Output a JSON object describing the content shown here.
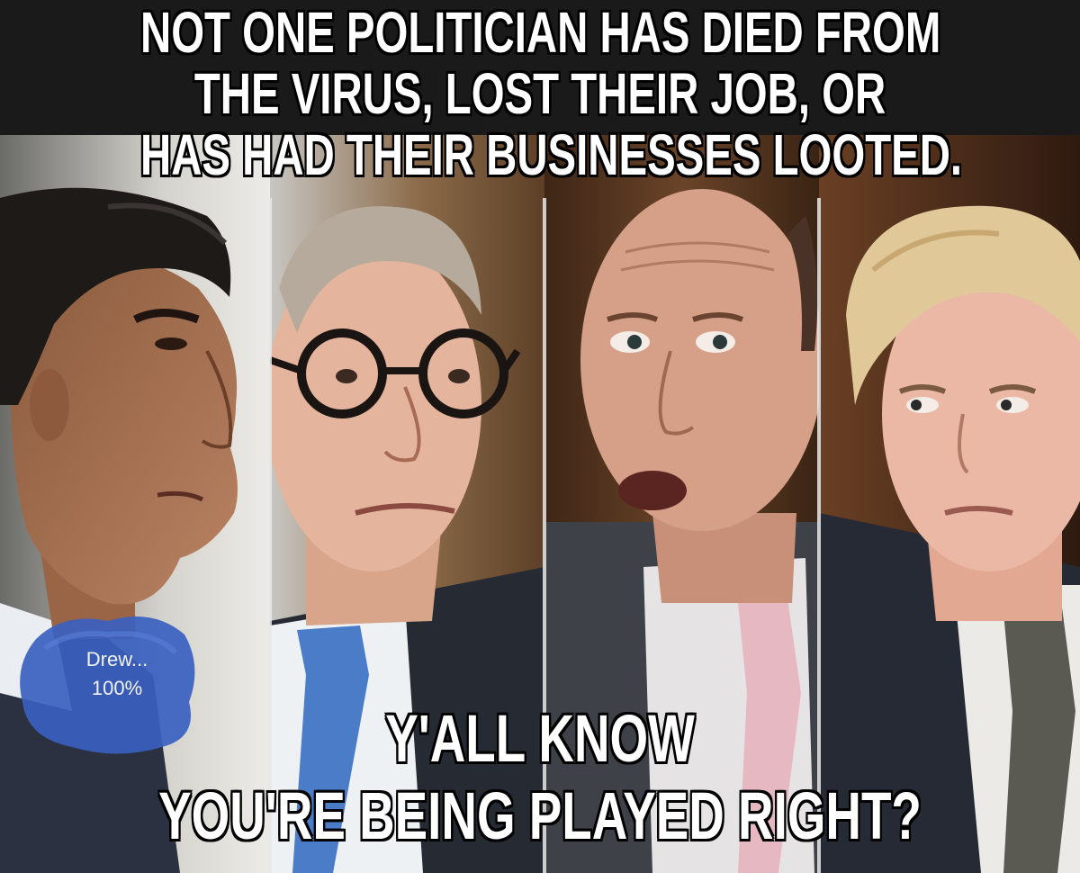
{
  "caption_top": {
    "line1": "NOT ONE POLITICIAN HAS DIED FROM",
    "line2": "THE VIRUS, LOST THEIR JOB, OR",
    "line3": "HAS HAD THEIR BUSINESSES LOOTED."
  },
  "caption_bottom": {
    "line1": "Y'ALL KNOW",
    "line2": "YOU'RE BEING PLAYED RIGHT?"
  },
  "sticker": {
    "line1": "Drew...",
    "line2": "100%",
    "color": "#3a5fc0"
  },
  "panels": [
    {
      "name": "man-in-profile-dark-hair",
      "background": "#d9d6d0"
    },
    {
      "name": "man-with-glasses-blue-tie",
      "background": "#7a5a3a"
    },
    {
      "name": "man-balding-pink-tie",
      "background": "#5a3a22"
    },
    {
      "name": "man-blond-hair-patterned-tie",
      "background": "#3a2418"
    }
  ]
}
